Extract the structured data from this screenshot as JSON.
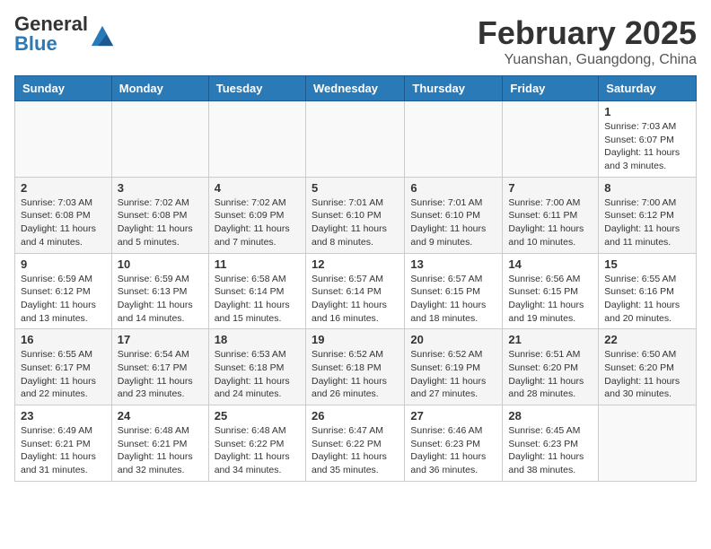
{
  "header": {
    "logo_general": "General",
    "logo_blue": "Blue",
    "month_title": "February 2025",
    "location": "Yuanshan, Guangdong, China"
  },
  "weekdays": [
    "Sunday",
    "Monday",
    "Tuesday",
    "Wednesday",
    "Thursday",
    "Friday",
    "Saturday"
  ],
  "weeks": [
    [
      {
        "day": "",
        "sunrise": "",
        "sunset": "",
        "daylight": ""
      },
      {
        "day": "",
        "sunrise": "",
        "sunset": "",
        "daylight": ""
      },
      {
        "day": "",
        "sunrise": "",
        "sunset": "",
        "daylight": ""
      },
      {
        "day": "",
        "sunrise": "",
        "sunset": "",
        "daylight": ""
      },
      {
        "day": "",
        "sunrise": "",
        "sunset": "",
        "daylight": ""
      },
      {
        "day": "",
        "sunrise": "",
        "sunset": "",
        "daylight": ""
      },
      {
        "day": "1",
        "sunrise": "Sunrise: 7:03 AM",
        "sunset": "Sunset: 6:07 PM",
        "daylight": "Daylight: 11 hours and 3 minutes."
      }
    ],
    [
      {
        "day": "2",
        "sunrise": "Sunrise: 7:03 AM",
        "sunset": "Sunset: 6:08 PM",
        "daylight": "Daylight: 11 hours and 4 minutes."
      },
      {
        "day": "3",
        "sunrise": "Sunrise: 7:02 AM",
        "sunset": "Sunset: 6:08 PM",
        "daylight": "Daylight: 11 hours and 5 minutes."
      },
      {
        "day": "4",
        "sunrise": "Sunrise: 7:02 AM",
        "sunset": "Sunset: 6:09 PM",
        "daylight": "Daylight: 11 hours and 7 minutes."
      },
      {
        "day": "5",
        "sunrise": "Sunrise: 7:01 AM",
        "sunset": "Sunset: 6:10 PM",
        "daylight": "Daylight: 11 hours and 8 minutes."
      },
      {
        "day": "6",
        "sunrise": "Sunrise: 7:01 AM",
        "sunset": "Sunset: 6:10 PM",
        "daylight": "Daylight: 11 hours and 9 minutes."
      },
      {
        "day": "7",
        "sunrise": "Sunrise: 7:00 AM",
        "sunset": "Sunset: 6:11 PM",
        "daylight": "Daylight: 11 hours and 10 minutes."
      },
      {
        "day": "8",
        "sunrise": "Sunrise: 7:00 AM",
        "sunset": "Sunset: 6:12 PM",
        "daylight": "Daylight: 11 hours and 11 minutes."
      }
    ],
    [
      {
        "day": "9",
        "sunrise": "Sunrise: 6:59 AM",
        "sunset": "Sunset: 6:12 PM",
        "daylight": "Daylight: 11 hours and 13 minutes."
      },
      {
        "day": "10",
        "sunrise": "Sunrise: 6:59 AM",
        "sunset": "Sunset: 6:13 PM",
        "daylight": "Daylight: 11 hours and 14 minutes."
      },
      {
        "day": "11",
        "sunrise": "Sunrise: 6:58 AM",
        "sunset": "Sunset: 6:14 PM",
        "daylight": "Daylight: 11 hours and 15 minutes."
      },
      {
        "day": "12",
        "sunrise": "Sunrise: 6:57 AM",
        "sunset": "Sunset: 6:14 PM",
        "daylight": "Daylight: 11 hours and 16 minutes."
      },
      {
        "day": "13",
        "sunrise": "Sunrise: 6:57 AM",
        "sunset": "Sunset: 6:15 PM",
        "daylight": "Daylight: 11 hours and 18 minutes."
      },
      {
        "day": "14",
        "sunrise": "Sunrise: 6:56 AM",
        "sunset": "Sunset: 6:15 PM",
        "daylight": "Daylight: 11 hours and 19 minutes."
      },
      {
        "day": "15",
        "sunrise": "Sunrise: 6:55 AM",
        "sunset": "Sunset: 6:16 PM",
        "daylight": "Daylight: 11 hours and 20 minutes."
      }
    ],
    [
      {
        "day": "16",
        "sunrise": "Sunrise: 6:55 AM",
        "sunset": "Sunset: 6:17 PM",
        "daylight": "Daylight: 11 hours and 22 minutes."
      },
      {
        "day": "17",
        "sunrise": "Sunrise: 6:54 AM",
        "sunset": "Sunset: 6:17 PM",
        "daylight": "Daylight: 11 hours and 23 minutes."
      },
      {
        "day": "18",
        "sunrise": "Sunrise: 6:53 AM",
        "sunset": "Sunset: 6:18 PM",
        "daylight": "Daylight: 11 hours and 24 minutes."
      },
      {
        "day": "19",
        "sunrise": "Sunrise: 6:52 AM",
        "sunset": "Sunset: 6:18 PM",
        "daylight": "Daylight: 11 hours and 26 minutes."
      },
      {
        "day": "20",
        "sunrise": "Sunrise: 6:52 AM",
        "sunset": "Sunset: 6:19 PM",
        "daylight": "Daylight: 11 hours and 27 minutes."
      },
      {
        "day": "21",
        "sunrise": "Sunrise: 6:51 AM",
        "sunset": "Sunset: 6:20 PM",
        "daylight": "Daylight: 11 hours and 28 minutes."
      },
      {
        "day": "22",
        "sunrise": "Sunrise: 6:50 AM",
        "sunset": "Sunset: 6:20 PM",
        "daylight": "Daylight: 11 hours and 30 minutes."
      }
    ],
    [
      {
        "day": "23",
        "sunrise": "Sunrise: 6:49 AM",
        "sunset": "Sunset: 6:21 PM",
        "daylight": "Daylight: 11 hours and 31 minutes."
      },
      {
        "day": "24",
        "sunrise": "Sunrise: 6:48 AM",
        "sunset": "Sunset: 6:21 PM",
        "daylight": "Daylight: 11 hours and 32 minutes."
      },
      {
        "day": "25",
        "sunrise": "Sunrise: 6:48 AM",
        "sunset": "Sunset: 6:22 PM",
        "daylight": "Daylight: 11 hours and 34 minutes."
      },
      {
        "day": "26",
        "sunrise": "Sunrise: 6:47 AM",
        "sunset": "Sunset: 6:22 PM",
        "daylight": "Daylight: 11 hours and 35 minutes."
      },
      {
        "day": "27",
        "sunrise": "Sunrise: 6:46 AM",
        "sunset": "Sunset: 6:23 PM",
        "daylight": "Daylight: 11 hours and 36 minutes."
      },
      {
        "day": "28",
        "sunrise": "Sunrise: 6:45 AM",
        "sunset": "Sunset: 6:23 PM",
        "daylight": "Daylight: 11 hours and 38 minutes."
      },
      {
        "day": "",
        "sunrise": "",
        "sunset": "",
        "daylight": ""
      }
    ]
  ]
}
